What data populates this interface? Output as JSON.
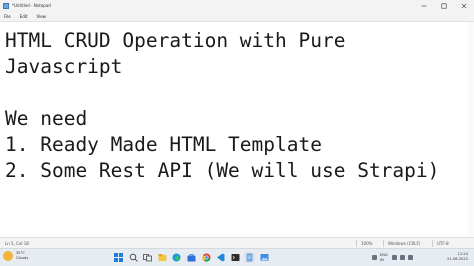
{
  "window": {
    "title": "*Untitled - Notepad",
    "controls": [
      "minimize-icon",
      "maximize-icon",
      "close-icon"
    ]
  },
  "menu": {
    "items": [
      "File",
      "Edit",
      "View"
    ]
  },
  "editor": {
    "lines": [
      "HTML CRUD Operation with Pure",
      "Javascript",
      "",
      "We need",
      "1. Ready Made HTML Template",
      "2. Some Rest API (We will use Strapi)"
    ]
  },
  "status": {
    "position": "Ln 5, Col 18",
    "zoom": "100%",
    "line_ending": "Windows (CRLF)",
    "encoding": "UTF-8"
  },
  "taskbar": {
    "weather": {
      "temp": "35°C",
      "condition": "Cloudy"
    },
    "apps": [
      "windows-start-icon",
      "search-icon",
      "task-view-icon",
      "file-explorer-icon",
      "edge-browser-icon",
      "store-icon",
      "chrome-icon",
      "vscode-icon",
      "terminal-icon",
      "notepad-icon",
      "photos-icon"
    ],
    "tray": {
      "lang": "ENG",
      "region": "IN"
    },
    "clock": {
      "time": "11:24",
      "date": "21-08-2022"
    }
  },
  "colors": {
    "accent": "#0067c0",
    "background": "#ffffff",
    "chrome": "#f3f3f3"
  }
}
